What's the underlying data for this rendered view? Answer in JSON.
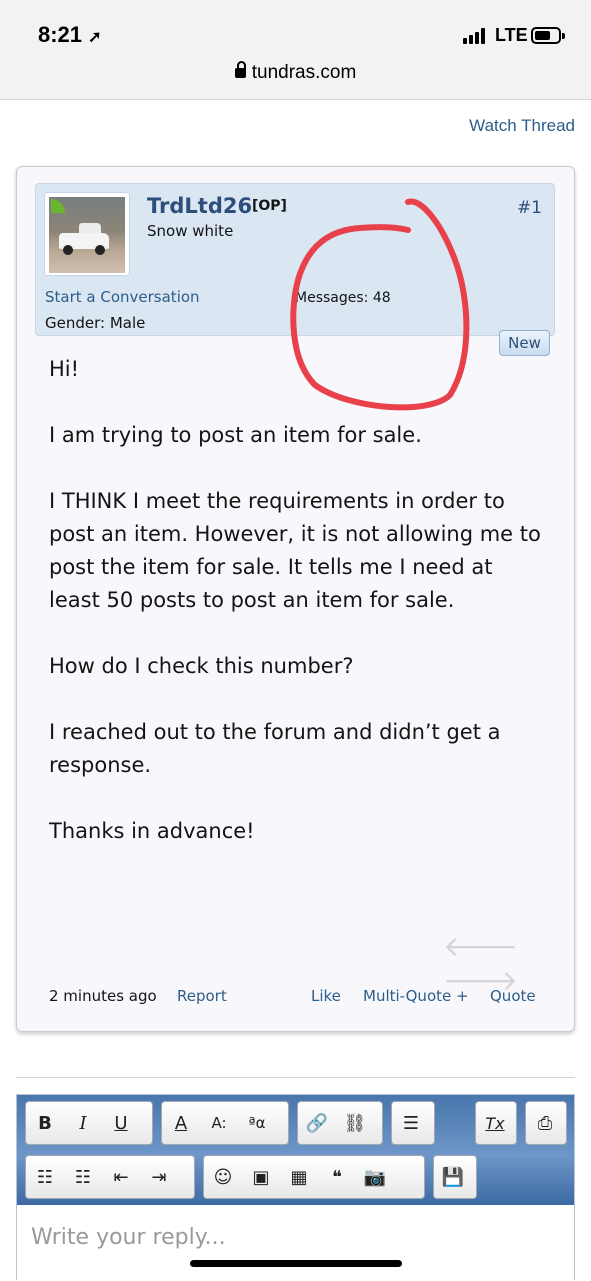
{
  "status_bar": {
    "time": "8:21",
    "network": "LTE",
    "location_glyph": "➚"
  },
  "browser": {
    "url": "tundras.com"
  },
  "thread": {
    "watch_label": "Watch Thread"
  },
  "post": {
    "username": "TrdLtd26",
    "op_tag": "[OP]",
    "user_title": "Snow white",
    "post_number": "#1",
    "start_conversation": "Start a Conversation",
    "messages": "Messages:  48",
    "gender": "Gender:  Male",
    "new_badge": "New",
    "body": [
      "Hi!",
      "I am trying to post an item for sale.",
      "I THINK I meet the requirements in order to post an item. However, it is not allowing me to post the item for sale. It tells me I need at least 50 posts to post an item for sale.",
      "How do I check this number?",
      "I reached out to the forum and didn’t get a response.",
      "Thanks in advance!"
    ],
    "prev_arrow": "🡐",
    "next_arrow": "🡒",
    "timestamp": "2 minutes ago",
    "report": "Report",
    "like": "Like",
    "multi_quote": "Multi-Quote +",
    "quote": "Quote"
  },
  "editor": {
    "placeholder": "Write your reply...",
    "toolbar": {
      "bold": "B",
      "italic": "I",
      "underline": "U",
      "text_color": "A",
      "font_size": "A:",
      "font_family": "ªα",
      "link": "🔗",
      "unlink": "⛓",
      "align": "☰",
      "remove_format": "Tx",
      "bulleted_list": "☷",
      "numbered_list": "☷",
      "outdent": "⇤",
      "indent": "⇥",
      "smilies": "☺",
      "image": "▣",
      "media": "▦",
      "quote": "❝",
      "camera": "📷",
      "save": "💾"
    }
  },
  "colors": {
    "link": "#2d5d8a",
    "userbar_bg": "#dbe6f3",
    "toolbar_blue": "#4976ad",
    "annotation_red": "#e8414c"
  }
}
